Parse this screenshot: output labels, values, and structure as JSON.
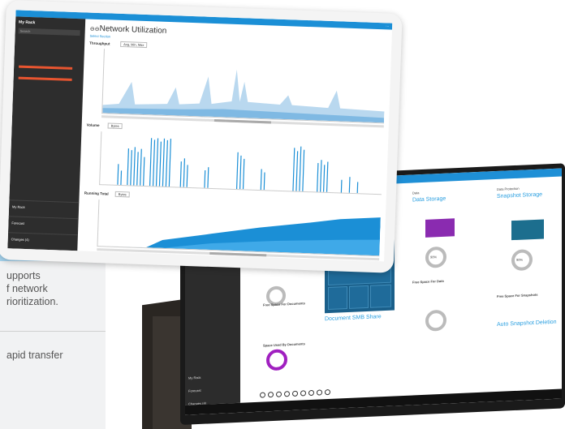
{
  "backdrop": {
    "text_lines": [
      "upports",
      "f network",
      "rioritization.",
      "apid transfer"
    ]
  },
  "tablet": {
    "title": "Network Utilization",
    "subtitle": "Select Section",
    "throughput_label": "Throughput",
    "throughput_select": "Avg, Min, Max",
    "volume_label": "Volume",
    "volume_select": "Bytes",
    "running_label": "Running Total",
    "running_select": "Bytes",
    "sidebar": {
      "header": "My Rack",
      "search_placeholder": "Search",
      "foot_items": [
        "My Rack",
        "Forecast",
        "Changes (4)"
      ]
    }
  },
  "monitor": {
    "col_titles": [
      "Data Storage",
      "Snapshot Storage"
    ],
    "section_labels": [
      "Data",
      "Data Protection"
    ],
    "treemap_title": "Document SMB Share",
    "auto_title": "Auto Snapshot Deletion",
    "sidebar_items": [
      "My Rack",
      "Forecast",
      "Changes (4)"
    ],
    "donut_labels": [
      "100%",
      "90%",
      "90%"
    ],
    "notes": [
      "Free Space For Documents",
      "Space Used By Documents",
      "Free Space For Data",
      "Free Space For Snapshots"
    ]
  },
  "colors": {
    "accent": "#1b8fd6",
    "sidebar_dark": "#2d2d2d",
    "purple": "#8a2bb0",
    "strip_blue": "#a8d7f2"
  }
}
